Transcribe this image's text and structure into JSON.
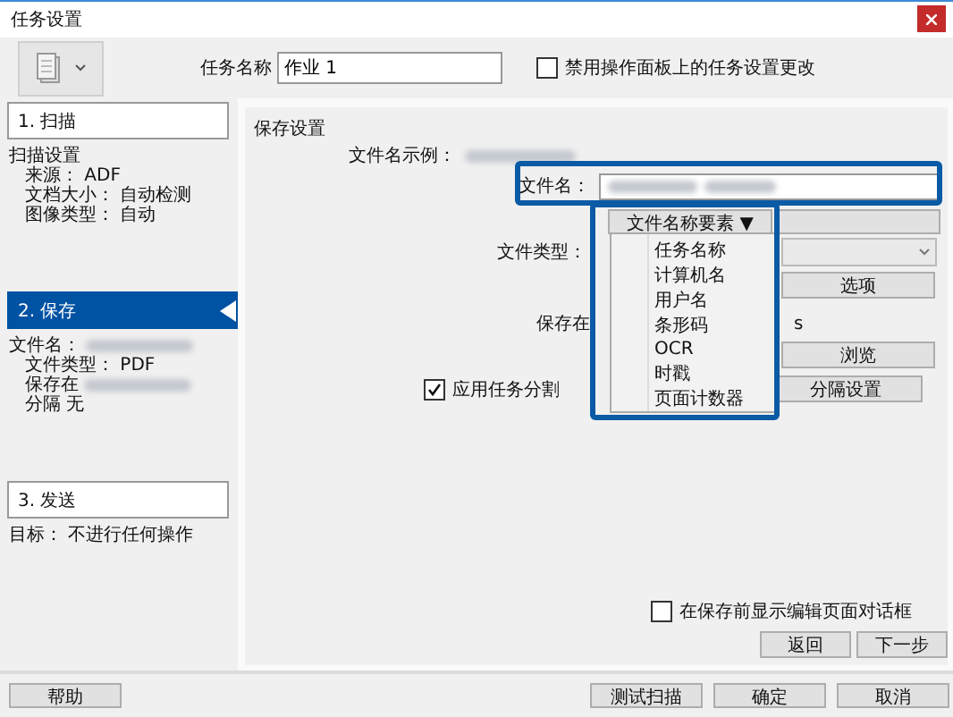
{
  "window": {
    "title": "任务设置"
  },
  "toolbar": {
    "job_name_label": "任务名称",
    "job_name": "作业 1",
    "lock": {
      "label": "禁用操作面板上的任务设置更改",
      "checked": false
    }
  },
  "steps": [
    {
      "label": "1. 扫描",
      "selected": false,
      "details": [
        {
          "text": "扫描设置",
          "children": [
            {
              "text": "来源： ADF"
            },
            {
              "text": "文档大小： 自动检测"
            },
            {
              "text": "图像类型： 自动"
            }
          ]
        }
      ]
    },
    {
      "label": "2. 保存",
      "selected": true,
      "details": [
        {
          "text": "文件名：",
          "redacted": true,
          "children": [
            {
              "text": "文件类型： PDF"
            },
            {
              "text": "保存在",
              "redacted": true
            },
            {
              "text": "分隔 无"
            }
          ]
        }
      ]
    },
    {
      "label": "3. 发送",
      "selected": false,
      "details": [
        {
          "text": "目标： 不进行任何操作"
        }
      ]
    }
  ],
  "save_settings": {
    "title": "保存设置",
    "example_label": "文件名示例：",
    "filename_label": "文件名：",
    "elements_button": "文件名称要素 ▼",
    "elements_menu": [
      "任务名称",
      "计算机名",
      "用户名",
      "条形码",
      "OCR",
      "时戳",
      "页面计数器"
    ],
    "file_type_label": "文件类型：",
    "options_button": "选项",
    "save_in_label": "保存在",
    "save_in_fragment": "s",
    "browse_button": "浏览",
    "split": {
      "label": "应用任务分割",
      "checked": true
    },
    "split_button": "分隔设置",
    "show_edit": {
      "label": "在保存前显示编辑页面对话框",
      "checked": false
    },
    "back_button": "返回",
    "next_button": "下一步"
  },
  "footer": {
    "help": "帮助",
    "buttons": [
      "测试扫描",
      "确定",
      "取消"
    ]
  }
}
